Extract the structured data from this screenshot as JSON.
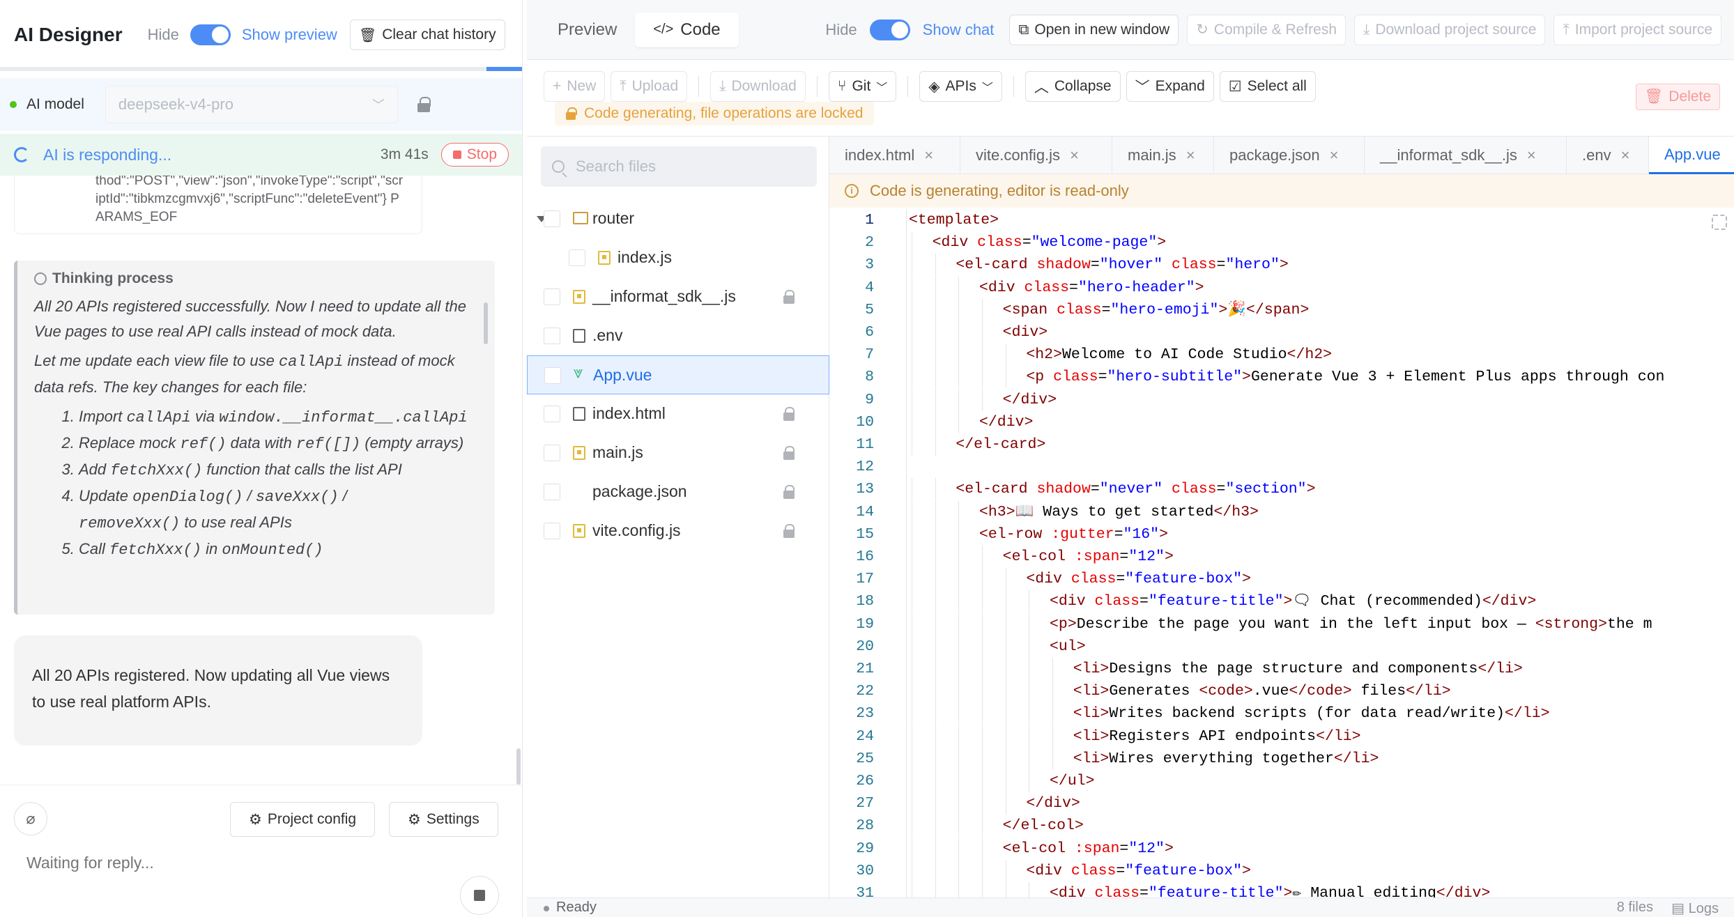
{
  "chat": {
    "app_title": "AI Designer",
    "hide_label": "Hide",
    "show_preview_label": "Show preview",
    "clear_history_label": "Clear chat history",
    "model_label": "AI model",
    "model_value": "deepseek-v4-pro",
    "responding_text": "AI is responding...",
    "elapsed": "3m 41s",
    "stop_label": "Stop",
    "tool_card_text": "thod\":\"POST\",\"view\":\"json\",\"invokeType\":\"script\",\"scriptId\":\"tibkmzcgmvxj6\",\"scriptFunc\":\"deleteEvent\"} PARAMS_EOF",
    "thinking_title": "Thinking process",
    "thinking_p1": "All 20 APIs registered successfully. Now I need to update all the Vue pages to use real API calls instead of mock data.",
    "thinking_p2_a": "Let me update each view file to use ",
    "thinking_p2_code": "callApi",
    "thinking_p2_b": " instead of mock data refs. The key changes for each file:",
    "steps": [
      {
        "a": "Import ",
        "code": "callApi",
        "b": " via ",
        "code2": "window.__informat__.callApi",
        "c": ""
      },
      {
        "a": "Replace mock ",
        "code": "ref()",
        "b": " data with ",
        "code2": "ref([])",
        "c": " (empty arrays)"
      },
      {
        "a": "Add ",
        "code": "fetchXxx()",
        "b": " function that calls the list API",
        "code2": "",
        "c": ""
      },
      {
        "a": "Update ",
        "code": "openDialog()",
        "b": " / ",
        "code2": "saveXxx()",
        "c": " /"
      },
      {
        "a": "",
        "code": "removeXxx()",
        "b": " to use real APIs",
        "code2": "",
        "c": ""
      },
      {
        "a": "Call ",
        "code": "fetchXxx()",
        "b": " in ",
        "code2": "onMounted()",
        "c": ""
      }
    ],
    "assistant_message": "All 20 APIs registered. Now updating all Vue views to use real platform APIs.",
    "project_config_label": "Project config",
    "settings_label": "Settings",
    "input_placeholder": "Waiting for reply..."
  },
  "code": {
    "tab_preview": "Preview",
    "tab_code": "Code",
    "hide_label": "Hide",
    "show_chat_label": "Show chat",
    "open_window_label": "Open in new window",
    "compile_label": "Compile & Refresh",
    "download_source_label": "Download project source",
    "import_source_label": "Import project source",
    "toolbar": {
      "new_label": "New",
      "upload_label": "Upload",
      "download_label": "Download",
      "git_label": "Git",
      "apis_label": "APIs",
      "collapse_label": "Collapse",
      "expand_label": "Expand",
      "select_all_label": "Select all",
      "delete_label": "Delete"
    },
    "lock_banner": "Code generating, file operations are locked",
    "search_placeholder": "Search files",
    "files": [
      {
        "name": "router",
        "type": "folder",
        "depth": 0,
        "locked": false,
        "selected": false,
        "expanded": true
      },
      {
        "name": "index.js",
        "type": "js",
        "depth": 1,
        "locked": false,
        "selected": false
      },
      {
        "name": "__informat_sdk__.js",
        "type": "js",
        "depth": 0,
        "locked": true,
        "selected": false
      },
      {
        "name": ".env",
        "type": "doc",
        "depth": 0,
        "locked": false,
        "selected": false
      },
      {
        "name": "App.vue",
        "type": "vue",
        "depth": 0,
        "locked": false,
        "selected": true
      },
      {
        "name": "index.html",
        "type": "doc",
        "depth": 0,
        "locked": true,
        "selected": false
      },
      {
        "name": "main.js",
        "type": "js",
        "depth": 0,
        "locked": true,
        "selected": false
      },
      {
        "name": "package.json",
        "type": "none",
        "depth": 0,
        "locked": true,
        "selected": false
      },
      {
        "name": "vite.config.js",
        "type": "js",
        "depth": 0,
        "locked": true,
        "selected": false
      }
    ],
    "open_tabs": [
      "index.html",
      "vite.config.js",
      "main.js",
      "package.json",
      "__informat_sdk__.js",
      ".env",
      "App.vue"
    ],
    "active_tab": "App.vue",
    "readonly_banner": "Code is generating, editor is read-only",
    "code_lines": [
      "<template>",
      "  <div class=\"welcome-page\">",
      "    <el-card shadow=\"hover\" class=\"hero\">",
      "      <div class=\"hero-header\">",
      "        <span class=\"hero-emoji\">🎉</span>",
      "        <div>",
      "          <h2>Welcome to AI Code Studio</h2>",
      "          <p class=\"hero-subtitle\">Generate Vue 3 + Element Plus apps through con",
      "        </div>",
      "      </div>",
      "    </el-card>",
      "",
      "    <el-card shadow=\"never\" class=\"section\">",
      "      <h3>📖 Ways to get started</h3>",
      "      <el-row :gutter=\"16\">",
      "        <el-col :span=\"12\">",
      "          <div class=\"feature-box\">",
      "            <div class=\"feature-title\">🗨 Chat (recommended)</div>",
      "            <p>Describe the page you want in the left input box — <strong>the m",
      "            <ul>",
      "              <li>Designs the page structure and components</li>",
      "              <li>Generates <code>.vue</code> files</li>",
      "              <li>Writes backend scripts (for data read/write)</li>",
      "              <li>Registers API endpoints</li>",
      "              <li>Wires everything together</li>",
      "            </ul>",
      "          </div>",
      "        </el-col>",
      "        <el-col :span=\"12\">",
      "          <div class=\"feature-box\">",
      "            <div class=\"feature-title\">✏ Manual editing</div>"
    ],
    "current_line": 1,
    "status_text": "Ready",
    "status_files": "8 files",
    "status_logs": "Logs"
  },
  "progress": {
    "chat_bar_fraction": 0.07
  }
}
